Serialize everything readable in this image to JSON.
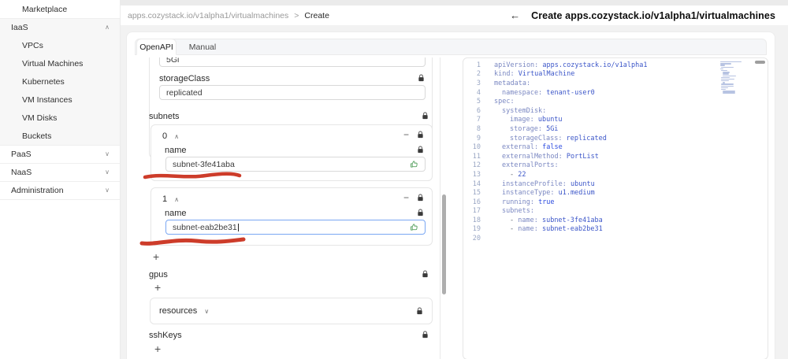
{
  "colors": {
    "focus_blue": "#7aa7f3",
    "marker_red": "#cd3c2a",
    "thumb_green": "#55a05e",
    "code_key": "#7b88c2",
    "code_value": "#3d57c9",
    "code_bool": "#2d4ce0",
    "line_number": "#9aa7c4"
  },
  "icons": {
    "chevron_up": "∧",
    "chevron_down": "∨",
    "minus": "−",
    "plus": "+",
    "back_arrow": "←",
    "breadcrumb_separator": ">"
  },
  "sidebar": {
    "items": [
      {
        "label": "Marketplace",
        "indent": 1,
        "chevron": null,
        "gray": false
      },
      {
        "label": "IaaS",
        "indent": 0,
        "chevron": "up",
        "gray": true
      },
      {
        "label": "VPCs",
        "indent": 1,
        "chevron": null,
        "gray": true
      },
      {
        "label": "Virtual Machines",
        "indent": 1,
        "chevron": null,
        "gray": true
      },
      {
        "label": "Kubernetes",
        "indent": 1,
        "chevron": null,
        "gray": true
      },
      {
        "label": "VM Instances",
        "indent": 1,
        "chevron": null,
        "gray": true
      },
      {
        "label": "VM Disks",
        "indent": 1,
        "chevron": null,
        "gray": true
      },
      {
        "label": "Buckets",
        "indent": 1,
        "chevron": null,
        "gray": true
      },
      {
        "label": "PaaS",
        "indent": 0,
        "chevron": "down",
        "gray": false
      },
      {
        "label": "NaaS",
        "indent": 0,
        "chevron": "down",
        "gray": false
      },
      {
        "label": "Administration",
        "indent": 0,
        "chevron": "down",
        "gray": false
      }
    ]
  },
  "header": {
    "breadcrumb_path": "apps.cozystack.io/v1alpha1/virtualmachines",
    "breadcrumb_current": "Create",
    "page_title": "Create apps.cozystack.io/v1alpha1/virtualmachines"
  },
  "form": {
    "tabs": [
      {
        "label": "OpenAPI"
      },
      {
        "label": "Manual"
      }
    ],
    "partial_field": {
      "value": "5Gi"
    },
    "storage_class": {
      "label": "storageClass",
      "value": "replicated"
    },
    "subnets": {
      "label": "subnets",
      "items": [
        {
          "index": "0",
          "name_label": "name",
          "value": "subnet-3fe41aba"
        },
        {
          "index": "1",
          "name_label": "name",
          "value": "subnet-eab2be31"
        }
      ]
    },
    "gpus": {
      "label": "gpus"
    },
    "resources": {
      "label": "resources"
    },
    "ssh_keys": {
      "label": "sshKeys"
    }
  },
  "editor": {
    "lines": [
      {
        "num": 1,
        "indent": 0,
        "tokens": [
          [
            "apiVersion:",
            "key"
          ],
          [
            " apps.cozystack.io/v1alpha1",
            "val"
          ]
        ]
      },
      {
        "num": 2,
        "indent": 0,
        "tokens": [
          [
            "kind:",
            "key"
          ],
          [
            " VirtualMachine",
            "val"
          ]
        ]
      },
      {
        "num": 3,
        "indent": 0,
        "tokens": [
          [
            "metadata:",
            "key"
          ]
        ]
      },
      {
        "num": 4,
        "indent": 2,
        "tokens": [
          [
            "namespace:",
            "key"
          ],
          [
            " tenant-user0",
            "val"
          ]
        ]
      },
      {
        "num": 5,
        "indent": 0,
        "tokens": [
          [
            "spec:",
            "key"
          ]
        ]
      },
      {
        "num": 6,
        "indent": 2,
        "tokens": [
          [
            "systemDisk:",
            "key"
          ]
        ]
      },
      {
        "num": 7,
        "indent": 4,
        "tokens": [
          [
            "image:",
            "key"
          ],
          [
            " ubuntu",
            "val"
          ]
        ]
      },
      {
        "num": 8,
        "indent": 4,
        "tokens": [
          [
            "storage:",
            "key"
          ],
          [
            " 5Gi",
            "val"
          ]
        ]
      },
      {
        "num": 9,
        "indent": 4,
        "tokens": [
          [
            "storageClass:",
            "key"
          ],
          [
            " replicated",
            "val"
          ]
        ]
      },
      {
        "num": 10,
        "indent": 2,
        "tokens": [
          [
            "external:",
            "key"
          ],
          [
            " false",
            "bool"
          ]
        ]
      },
      {
        "num": 11,
        "indent": 2,
        "tokens": [
          [
            "externalMethod:",
            "key"
          ],
          [
            " PortList",
            "val"
          ]
        ]
      },
      {
        "num": 12,
        "indent": 2,
        "tokens": [
          [
            "externalPorts:",
            "key"
          ]
        ]
      },
      {
        "num": 13,
        "indent": 4,
        "tokens": [
          [
            "- ",
            "plain"
          ],
          [
            "22",
            "val"
          ]
        ]
      },
      {
        "num": 14,
        "indent": 2,
        "tokens": [
          [
            "instanceProfile:",
            "key"
          ],
          [
            " ubuntu",
            "val"
          ]
        ]
      },
      {
        "num": 15,
        "indent": 2,
        "tokens": [
          [
            "instanceType:",
            "key"
          ],
          [
            " u1.medium",
            "val"
          ]
        ]
      },
      {
        "num": 16,
        "indent": 2,
        "tokens": [
          [
            "running:",
            "key"
          ],
          [
            " true",
            "bool"
          ]
        ]
      },
      {
        "num": 17,
        "indent": 2,
        "tokens": [
          [
            "subnets:",
            "key"
          ]
        ]
      },
      {
        "num": 18,
        "indent": 4,
        "tokens": [
          [
            "- ",
            "plain"
          ],
          [
            "name:",
            "key"
          ],
          [
            " subnet-3fe41aba",
            "val"
          ]
        ]
      },
      {
        "num": 19,
        "indent": 4,
        "tokens": [
          [
            "- ",
            "plain"
          ],
          [
            "name:",
            "key"
          ],
          [
            " subnet-eab2be31",
            "val"
          ]
        ]
      },
      {
        "num": 20,
        "indent": 0,
        "tokens": []
      }
    ]
  }
}
